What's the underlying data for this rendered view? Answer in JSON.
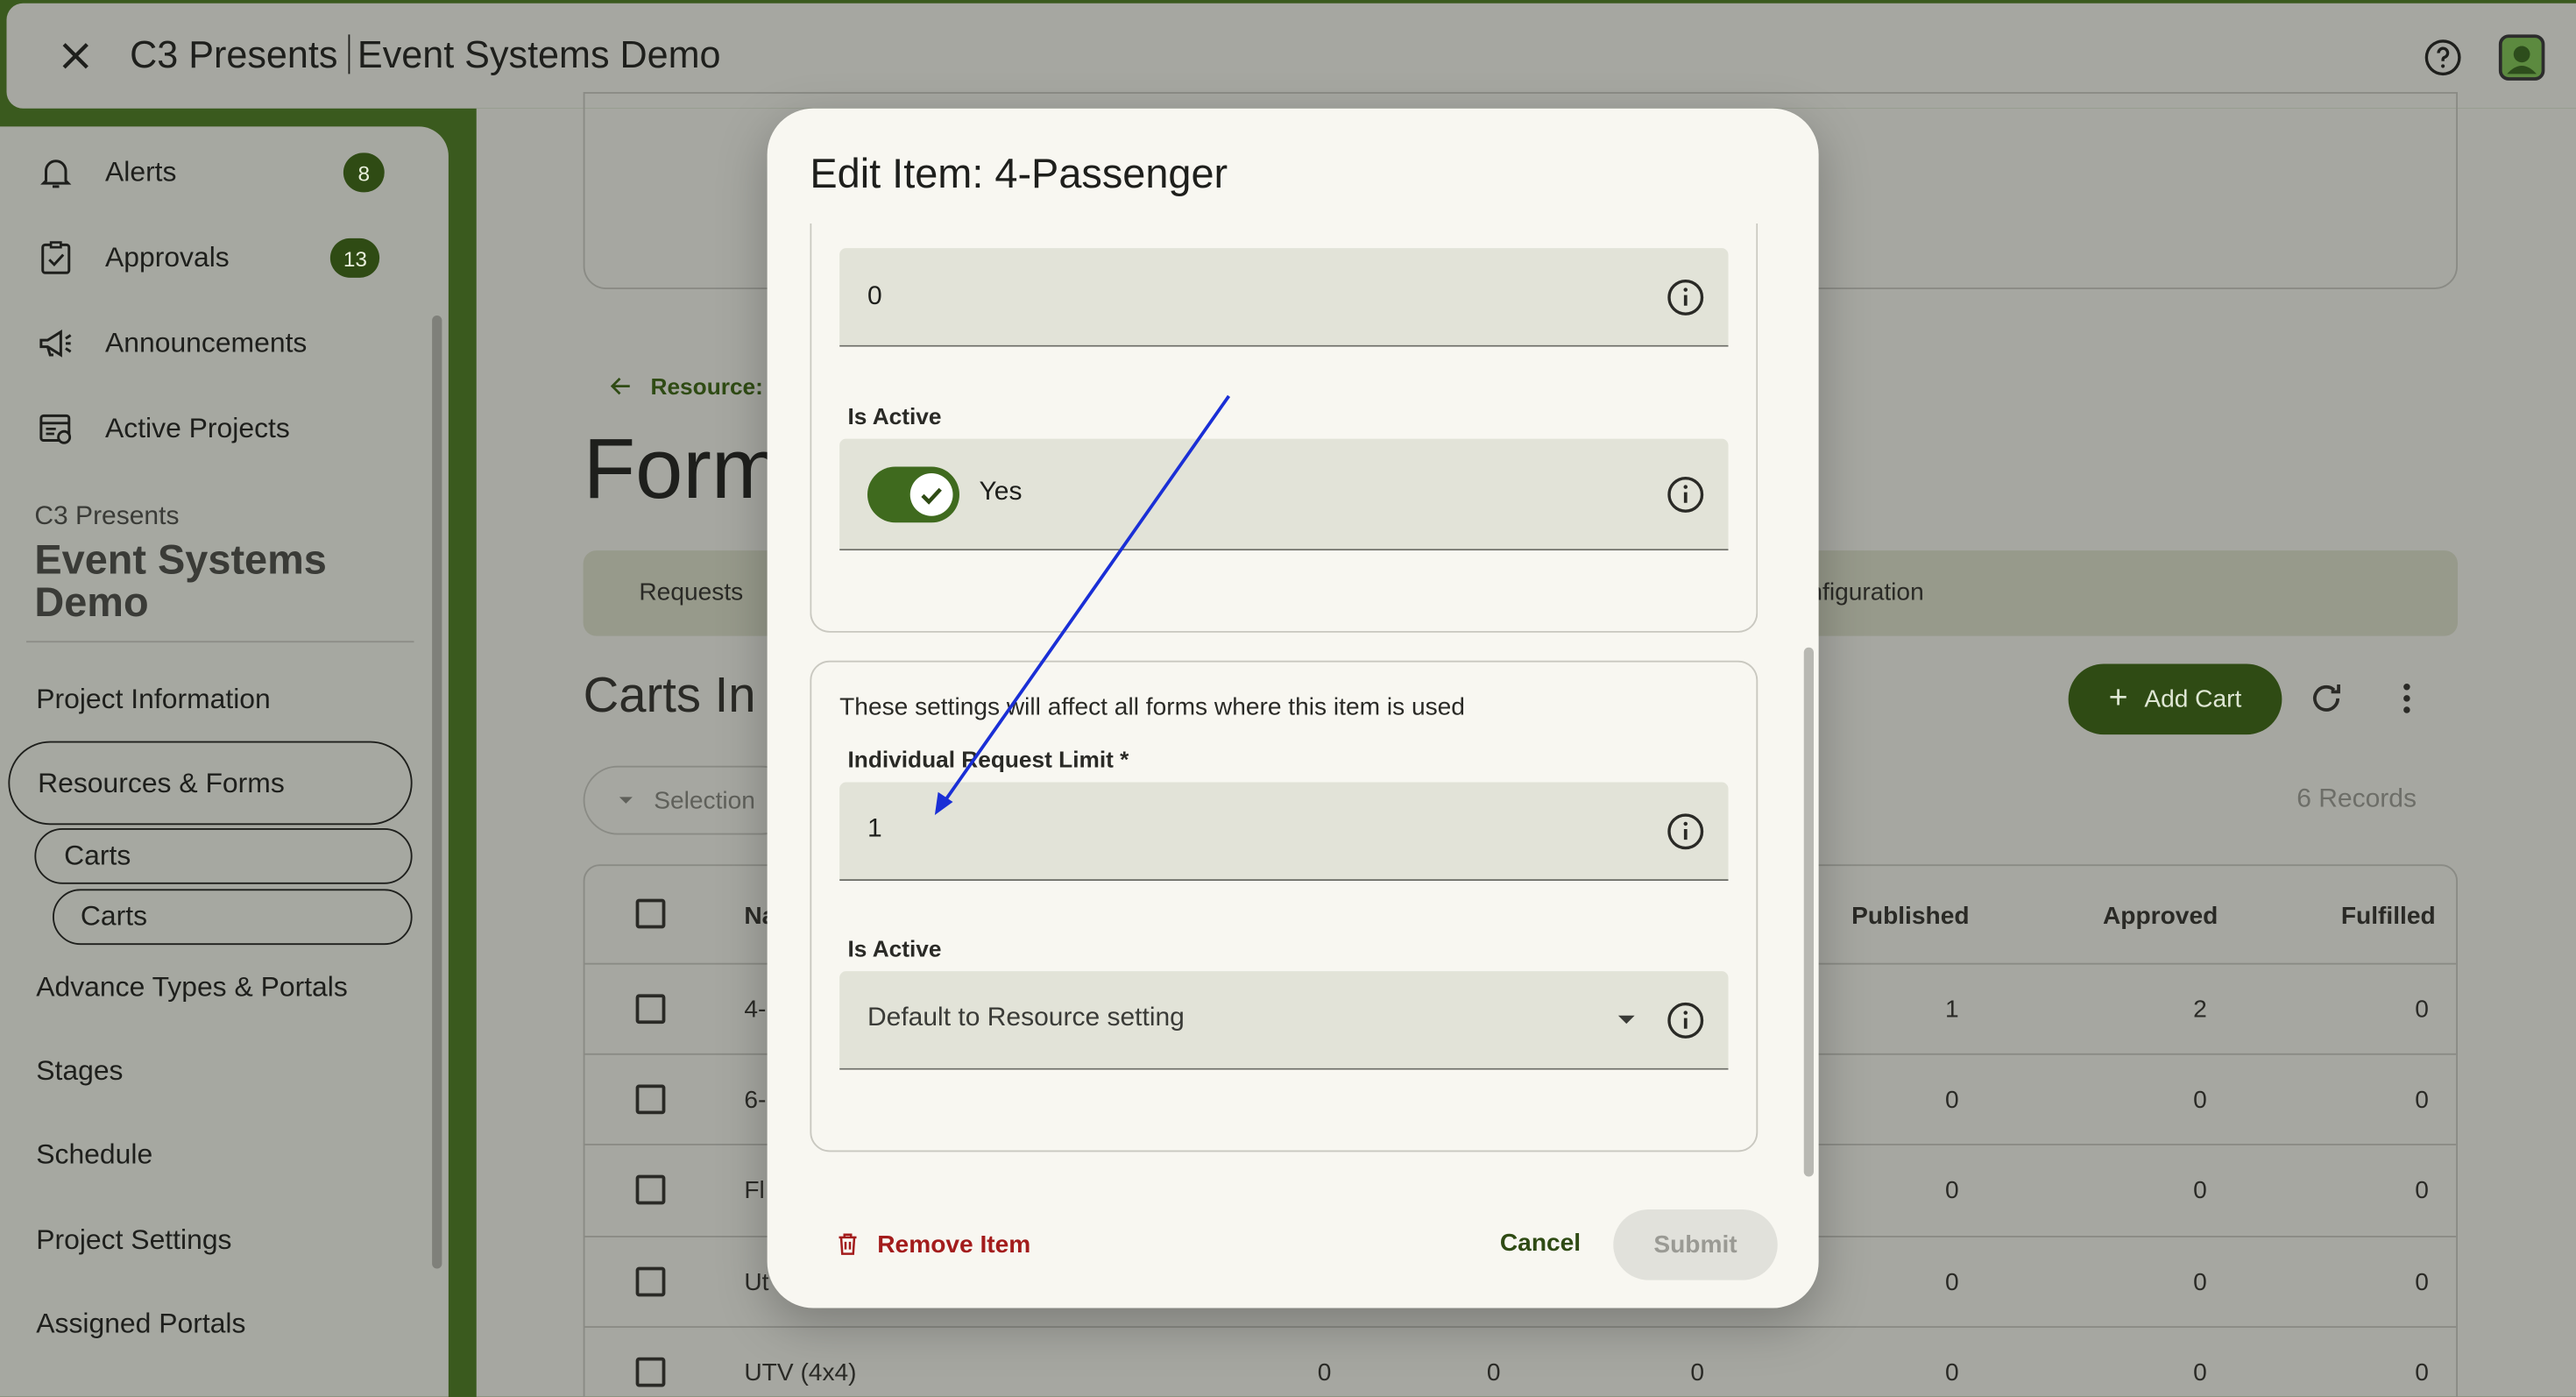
{
  "topbar": {
    "org": "C3 Presents",
    "project": "Event Systems Demo"
  },
  "sidebar": {
    "items": [
      {
        "label": "Alerts",
        "badge": "8",
        "icon": "bell-icon"
      },
      {
        "label": "Approvals",
        "badge": "13",
        "icon": "clipboard-check-icon"
      },
      {
        "label": "Announcements",
        "icon": "megaphone-icon"
      },
      {
        "label": "Active Projects",
        "icon": "projects-icon"
      }
    ],
    "org_small": "C3 Presents",
    "org_big": "Event Systems Demo",
    "links": [
      {
        "label": "Project Information"
      },
      {
        "label": "Resources & Forms"
      },
      {
        "label": "Carts"
      },
      {
        "label": "Carts"
      },
      {
        "label": "Advance Types & Portals"
      },
      {
        "label": "Stages"
      },
      {
        "label": "Schedule"
      },
      {
        "label": "Project Settings"
      },
      {
        "label": "Assigned Portals"
      }
    ]
  },
  "main": {
    "back_label": "Resource:",
    "page_title": "Form",
    "tabs": [
      "Requests",
      "nfiguration"
    ],
    "section_title": "Carts In",
    "add_cart_label": "Add Cart",
    "selection_label": "Selection",
    "records": "6 Records",
    "table": {
      "headers": [
        "Na",
        "Published",
        "Approved",
        "Fulfilled"
      ],
      "rows": [
        {
          "name": "4-",
          "published": "1",
          "approved": "2",
          "fulfilled": "0"
        },
        {
          "name": "6-",
          "published": "0",
          "approved": "0",
          "fulfilled": "0"
        },
        {
          "name": "Fl",
          "published": "0",
          "approved": "0",
          "fulfilled": "0"
        },
        {
          "name": "Ut",
          "published": "0",
          "approved": "0",
          "fulfilled": "0"
        },
        {
          "name": "UTV (4x4)",
          "c1": "0",
          "c2": "0",
          "c3": "0",
          "published": "0",
          "approved": "0",
          "fulfilled": "0"
        }
      ]
    }
  },
  "modal": {
    "title": "Edit Item: 4-Passenger",
    "top_field_value": "0",
    "is_active_label": "Is Active",
    "toggle_label": "Yes",
    "settings_note": "These settings will affect all forms where this item is used",
    "limit_label": "Individual Request Limit *",
    "limit_value": "1",
    "is_active_label_2": "Is Active",
    "is_active_select": "Default to Resource setting",
    "remove_label": "Remove Item",
    "cancel_label": "Cancel",
    "submit_label": "Submit"
  },
  "colors": {
    "brand_green": "#2f4b14",
    "remove_red": "#a31c1c",
    "annotation_arrow": "#1a2fd6"
  }
}
